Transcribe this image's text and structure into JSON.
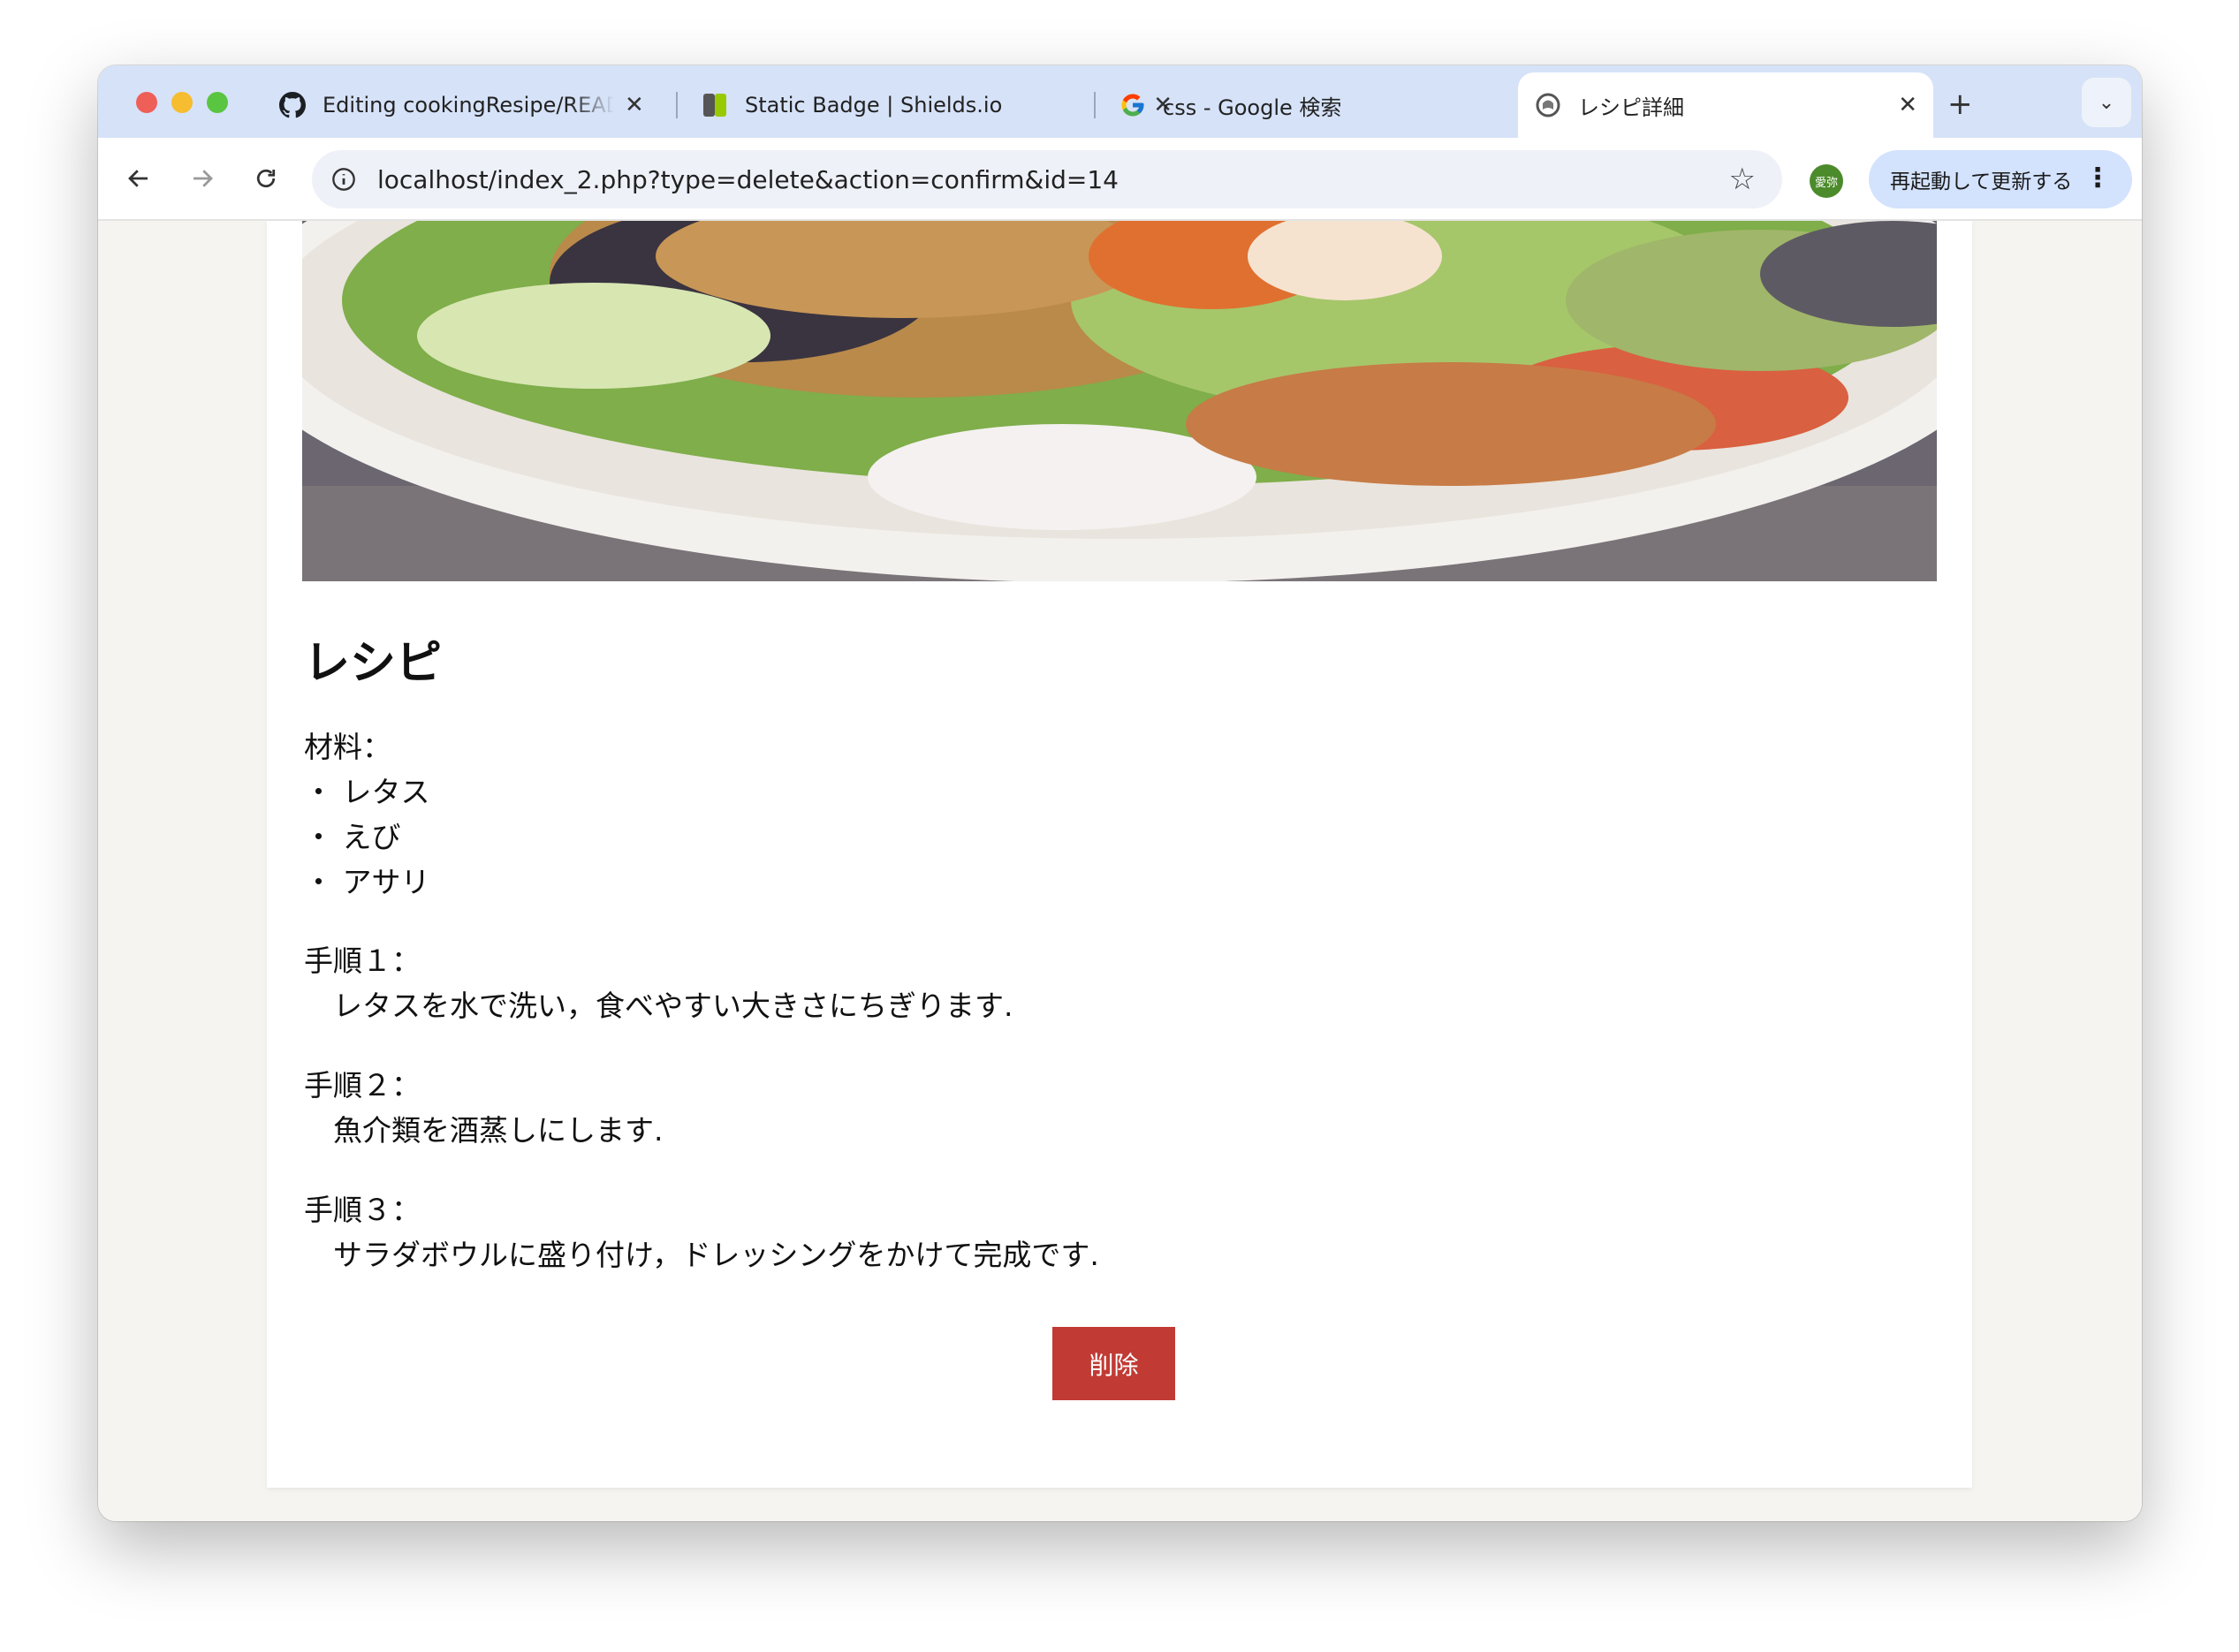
{
  "tabs": [
    {
      "title": "Editing cookingResipe/README.md",
      "icon": "github-icon"
    },
    {
      "title": "Static Badge | Shields.io",
      "icon": "shields-icon"
    },
    {
      "title": "css - Google 検索",
      "icon": "google-icon"
    },
    {
      "title": "レシピ詳細",
      "icon": "page-icon",
      "active": true
    }
  ],
  "toolbar": {
    "url": "localhost/index_2.php?type=delete&action=confirm&id=14",
    "avatar_text": "愛弥",
    "update_label": "再起動して更新する"
  },
  "recipe": {
    "title": "レシピ",
    "ingredients_label": "材料：",
    "ingredients": [
      "・ レタス",
      "・ えび",
      "・ アサリ"
    ],
    "steps": [
      {
        "label": "手順１：",
        "text": "　レタスを水で洗い，食べやすい大きさにちぎります."
      },
      {
        "label": "手順２：",
        "text": "　魚介類を酒蒸しにします."
      },
      {
        "label": "手順３：",
        "text": "　サラダボウルに盛り付け，ドレッシングをかけて完成です."
      }
    ],
    "delete_label": "削除"
  },
  "colors": {
    "tabstrip": "#d6e2f8",
    "delete_button": "#c13a34",
    "page_background": "#f5f4f0"
  }
}
